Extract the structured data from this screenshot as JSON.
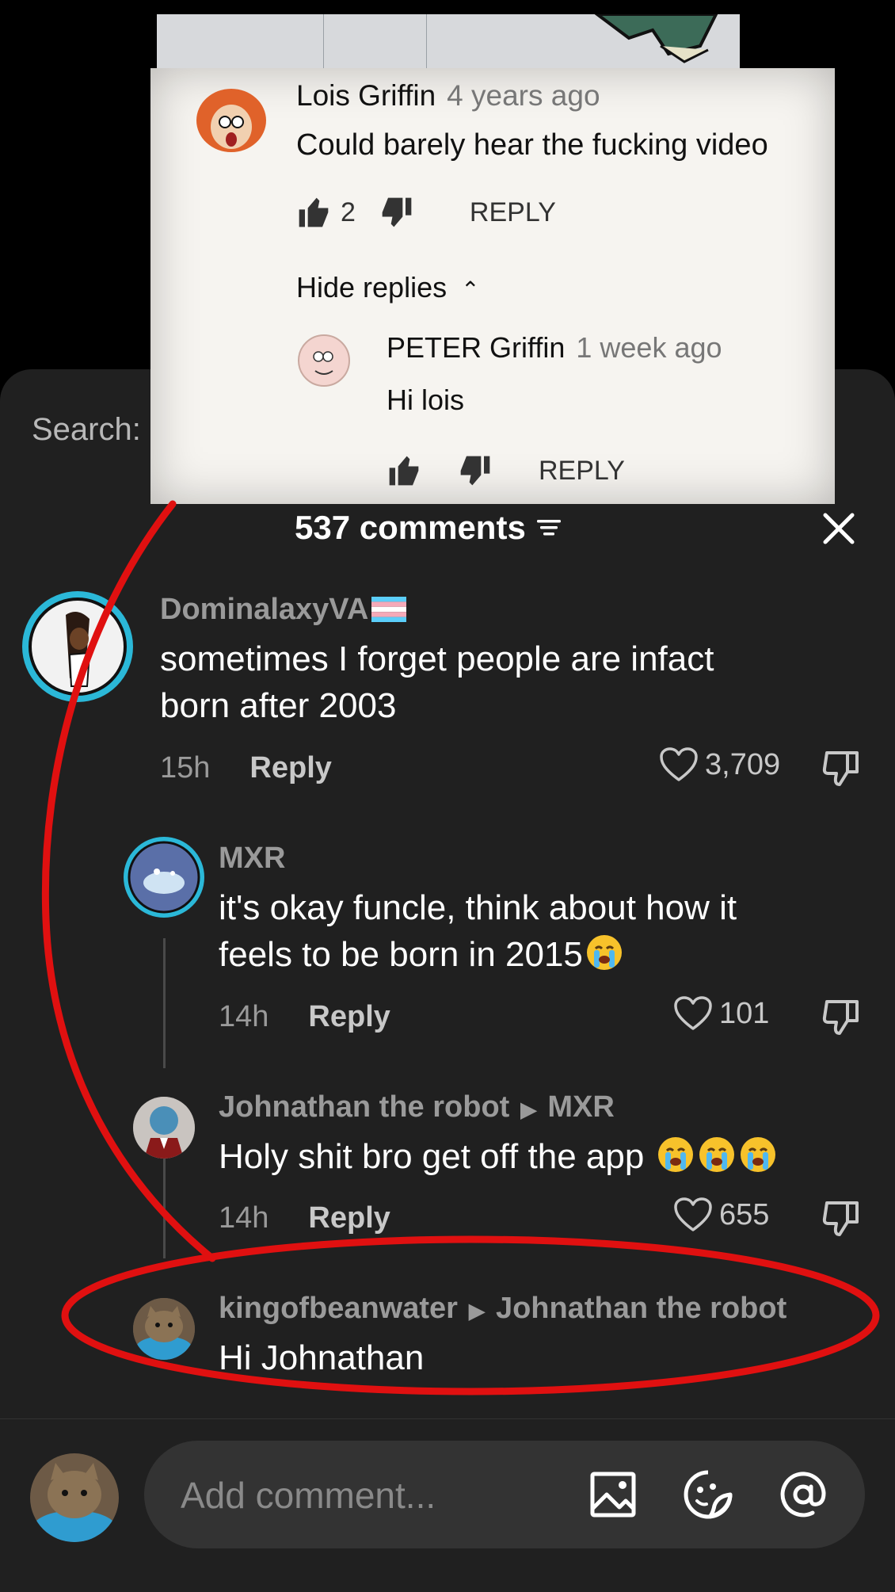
{
  "youtube_screenshot": {
    "comment": {
      "author": "Lois Griffin",
      "age": "4 years ago",
      "text": "Could barely hear the fucking video",
      "likes": "2",
      "reply_label": "REPLY"
    },
    "hide_replies_label": "Hide replies",
    "reply": {
      "author": "PETER Griffin",
      "age": "1 week ago",
      "text": "Hi lois",
      "reply_label": "REPLY"
    }
  },
  "search_label": "Search:",
  "comments_header": {
    "title": "537 comments"
  },
  "comments": [
    {
      "username": "DominalaxyVA",
      "text_lines": [
        "sometimes I forget people are infact",
        "born after 2003"
      ],
      "time": "15h",
      "reply_label": "Reply",
      "likes": "3,709"
    },
    {
      "username": "MXR",
      "text_lines": [
        "it's okay funcle, think about how it",
        "feels to be born in 2015"
      ],
      "time": "14h",
      "reply_label": "Reply",
      "likes": "101"
    },
    {
      "username": "Johnathan the robot",
      "reply_to": "MXR",
      "text": "Holy shit bro get off the app",
      "time": "14h",
      "reply_label": "Reply",
      "likes": "655"
    },
    {
      "username": "kingofbeanwater",
      "reply_to": "Johnathan the robot",
      "text": "Hi Johnathan"
    }
  ],
  "composer": {
    "placeholder": "Add comment..."
  },
  "icons": {
    "filter": "filter-icon",
    "close": "close-icon",
    "heart": "heart-icon",
    "dislike": "dislike-icon",
    "image": "image-icon",
    "sticker": "sticker-icon",
    "mention": "at-mention-icon"
  },
  "colors": {
    "sheet_bg": "#202020",
    "annotation_red": "#e01010",
    "avatar_ring": "#2bb8d8"
  }
}
